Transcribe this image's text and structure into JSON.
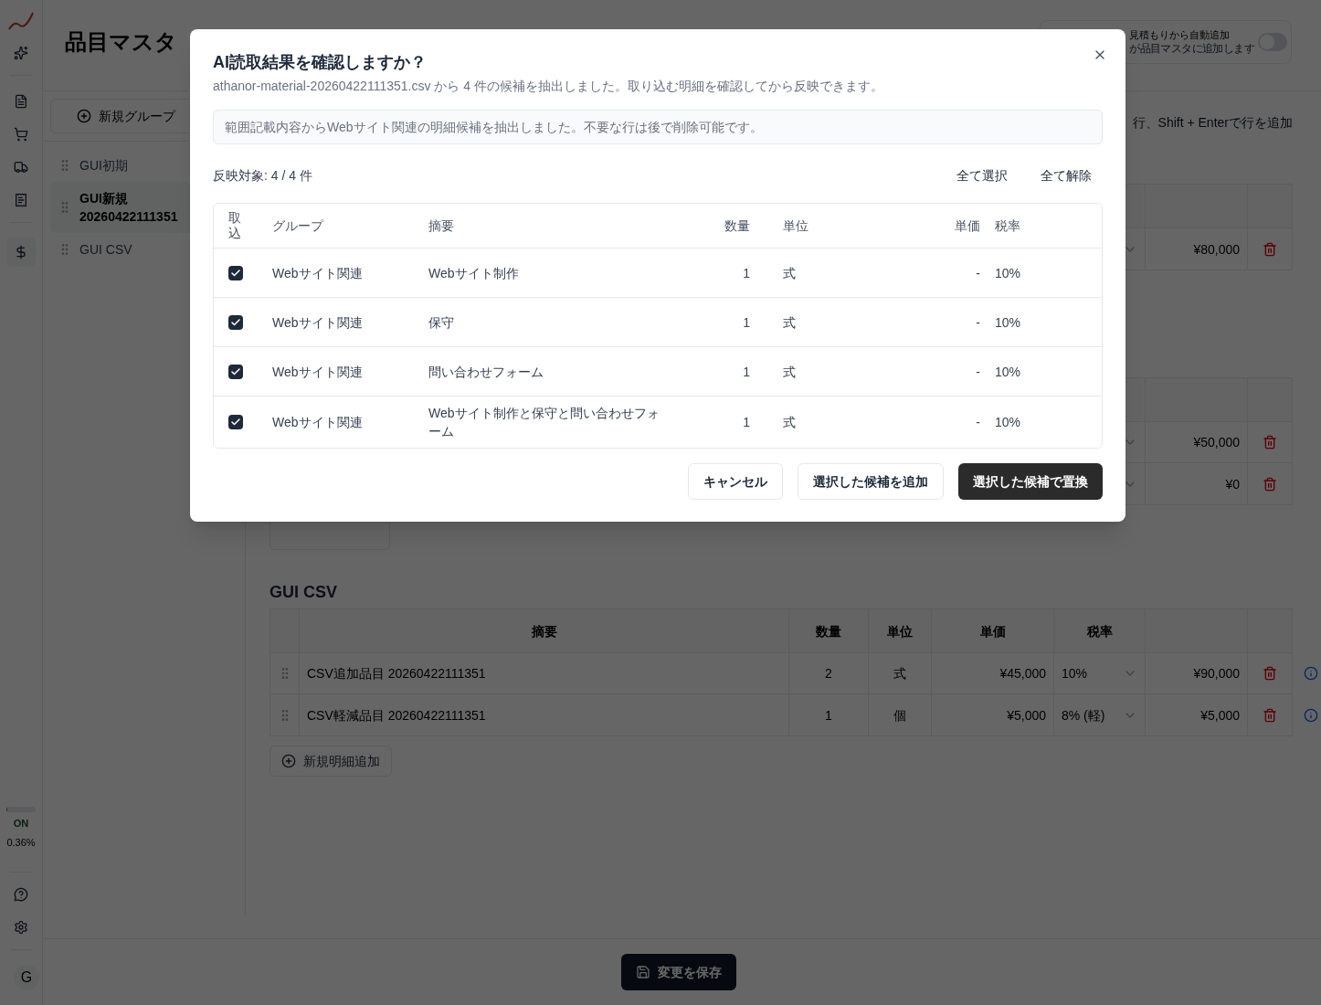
{
  "page": {
    "title": "品目マスタ",
    "auto_add": {
      "label": "見積もりから自動追加",
      "description": "が品目マスタに追加します",
      "on": false
    },
    "hint": "行、Shift + Enterで行を追加"
  },
  "sidebar": {
    "status": {
      "label": "ON",
      "reading": "0.36%",
      "level": 0.03
    },
    "avatar": "G"
  },
  "groups": {
    "new_button": "新規グループ",
    "items": [
      {
        "name": "GUI初期",
        "selected": false
      },
      {
        "name": "GUI新規",
        "code": "20260422111351",
        "selected": true
      },
      {
        "name": "GUI CSV",
        "selected": false
      }
    ]
  },
  "sections": [
    {
      "rows": [
        {
          "amount": "¥80,000"
        }
      ]
    },
    {
      "rows": [
        {
          "amount": "¥50,000"
        },
        {
          "amount": "¥0"
        }
      ]
    },
    {
      "title": "GUI CSV",
      "columns": [
        "摘要",
        "数量",
        "単位",
        "単価",
        "税率"
      ],
      "rows": [
        {
          "description": "CSV追加品目 20260422111351",
          "quantity": "2",
          "unit": "式",
          "unit_price": "¥45,000",
          "tax": "10%",
          "amount": "¥90,000"
        },
        {
          "description": "CSV軽減品目 20260422111351",
          "quantity": "1",
          "unit": "個",
          "unit_price": "¥5,000",
          "tax": "8% (軽)",
          "amount": "¥5,000"
        }
      ],
      "add_button": "新規明細追加"
    }
  ],
  "save_button": "変更を保存",
  "dialog": {
    "title": "AI読取結果を確認しますか？",
    "subtitle": "athanor-material-20260422111351.csv から 4 件の候補を抽出しました。取り込む明細を確認してから反映できます。",
    "note": "範囲記載内容からWebサイト関連の明細候補を抽出しました。不要な行は後で削除可能です。",
    "count": "反映対象: 4 / 4 件",
    "select_all": "全て選択",
    "clear_all": "全て解除",
    "columns": [
      "取込",
      "グループ",
      "摘要",
      "数量",
      "単位",
      "単価",
      "税率"
    ],
    "rows": [
      {
        "checked": true,
        "group": "Webサイト関連",
        "description": "Webサイト制作",
        "quantity": "1",
        "unit": "式",
        "unit_price": "-",
        "tax": "10%"
      },
      {
        "checked": true,
        "group": "Webサイト関連",
        "description": "保守",
        "quantity": "1",
        "unit": "式",
        "unit_price": "-",
        "tax": "10%"
      },
      {
        "checked": true,
        "group": "Webサイト関連",
        "description": "問い合わせフォーム",
        "quantity": "1",
        "unit": "式",
        "unit_price": "-",
        "tax": "10%"
      },
      {
        "checked": true,
        "group": "Webサイト関連",
        "description": "Webサイト制作と保守と問い合わせフォーム",
        "quantity": "1",
        "unit": "式",
        "unit_price": "-",
        "tax": "10%"
      }
    ],
    "buttons": [
      {
        "label": "キャンセル",
        "kind": "secondary"
      },
      {
        "label": "選択した候補を追加",
        "kind": "secondary"
      },
      {
        "label": "選択した候補で置換",
        "kind": "primary"
      }
    ]
  }
}
